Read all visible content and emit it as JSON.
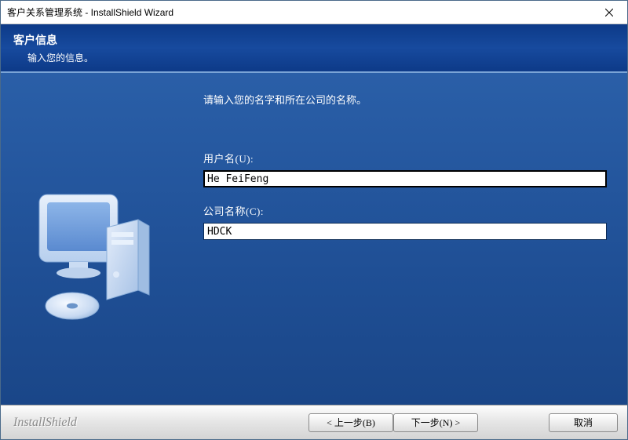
{
  "window": {
    "title": "客户关系管理系统 - InstallShield Wizard"
  },
  "header": {
    "title": "客户信息",
    "subtitle": "输入您的信息。"
  },
  "form": {
    "instruction": "请输入您的名字和所在公司的名称。",
    "username_label": "用户名(U):",
    "username_value": "He FeiFeng",
    "company_label": "公司名称(C):",
    "company_value": "HDCK"
  },
  "footer": {
    "brand": "InstallShield",
    "back_label": "< 上一步(B)",
    "next_label": "下一步(N) >",
    "cancel_label": "取消"
  }
}
